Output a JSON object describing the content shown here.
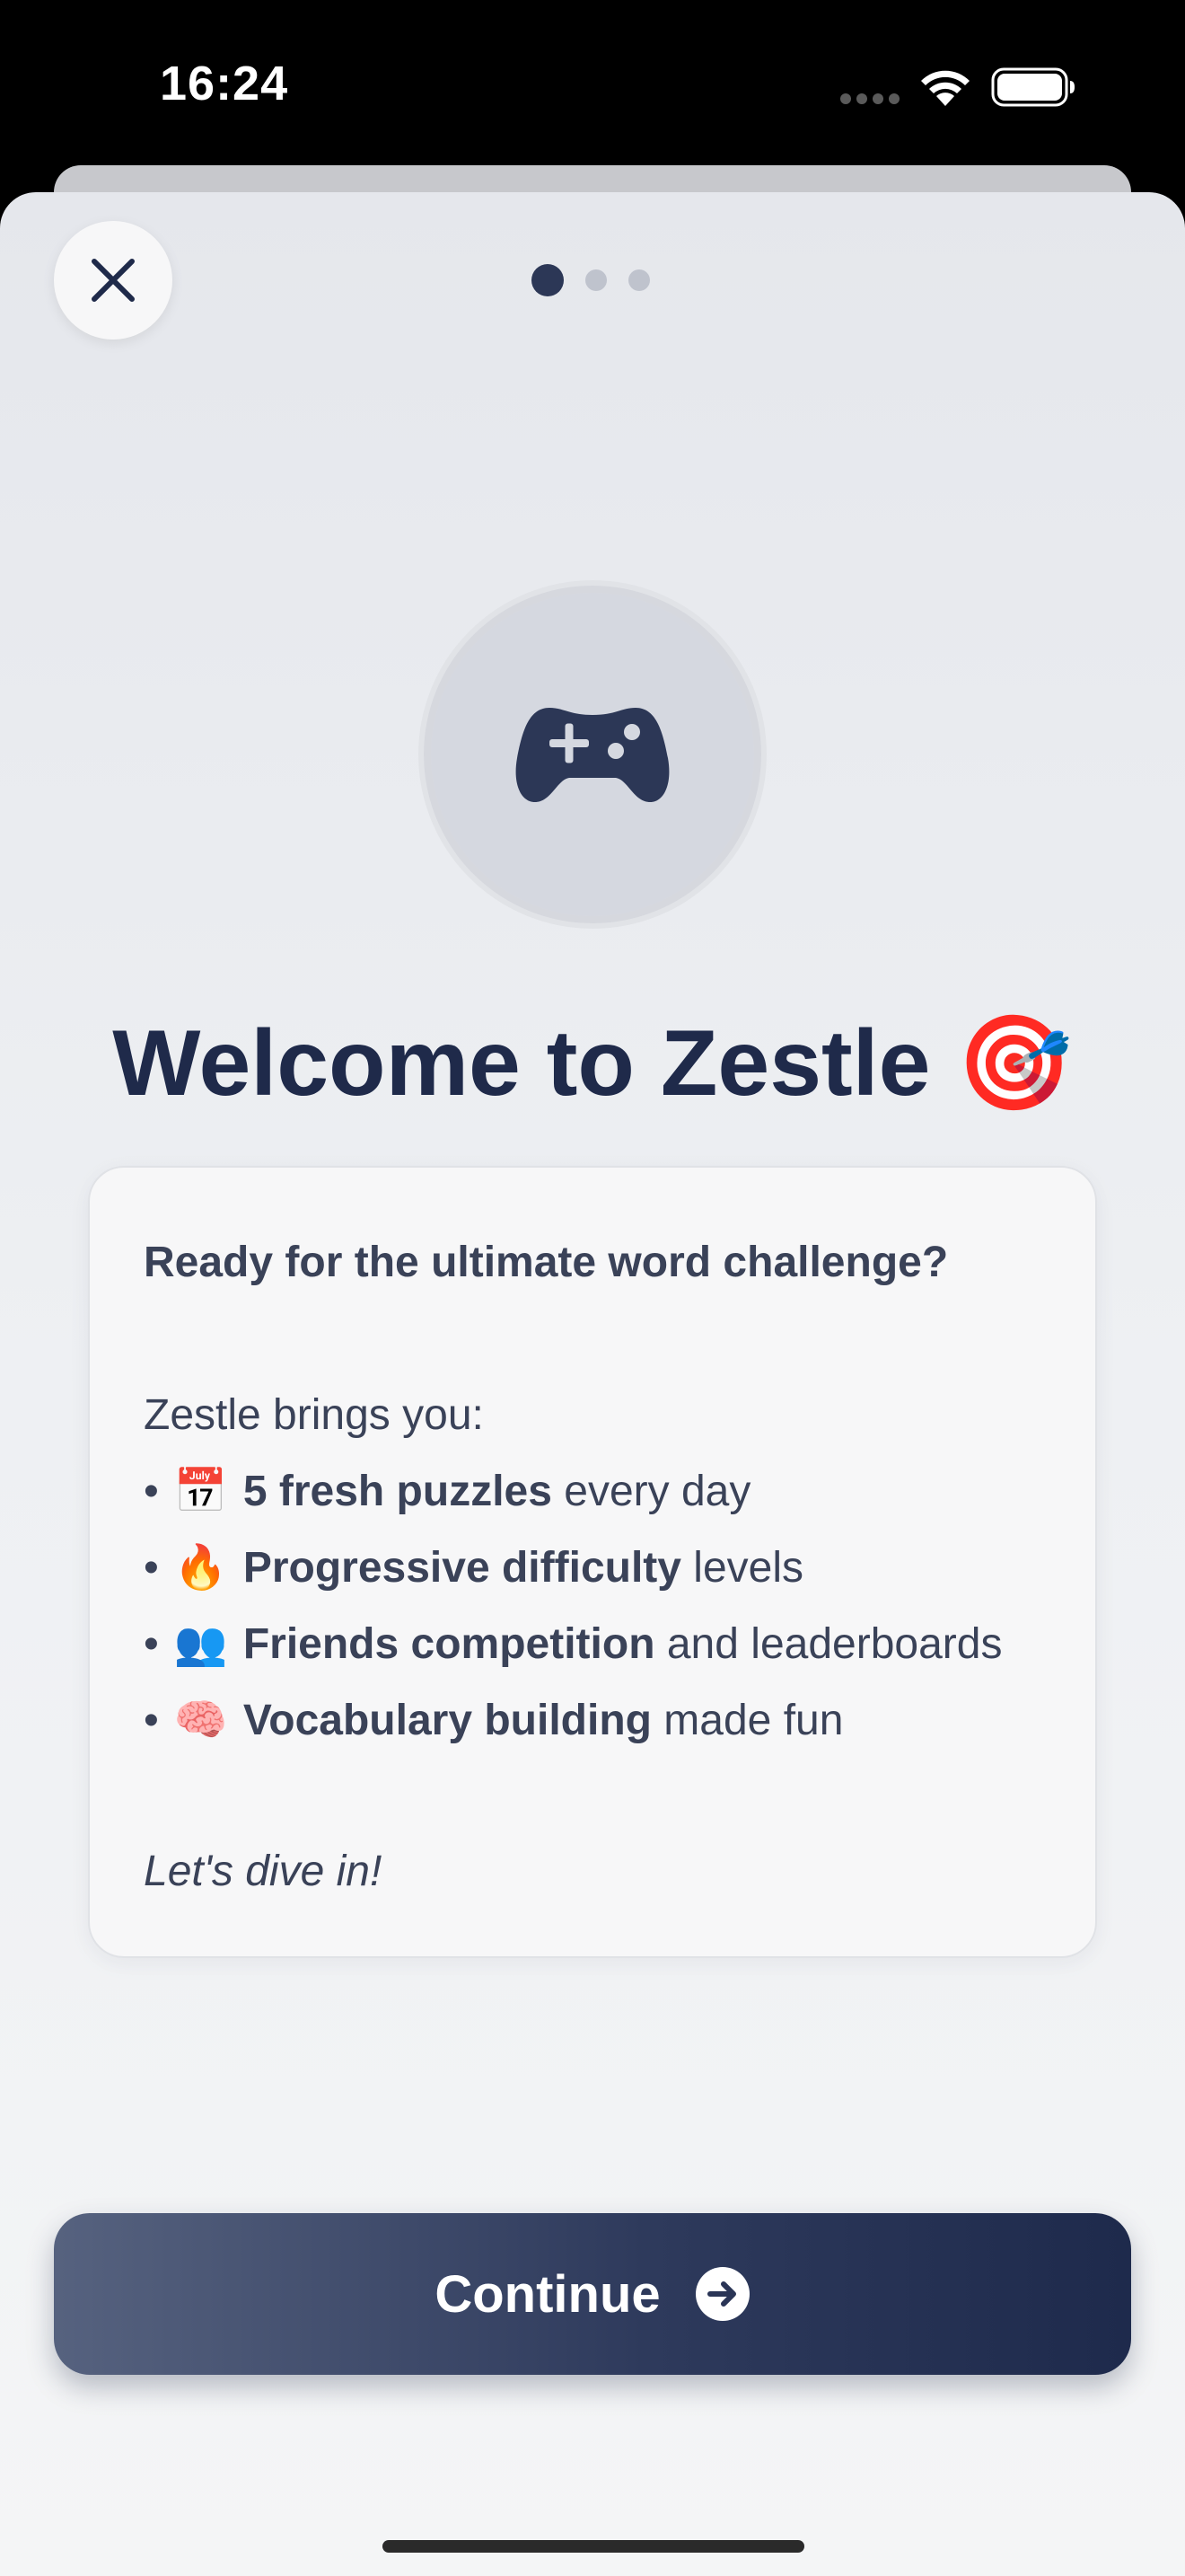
{
  "status_bar": {
    "time": "16:24"
  },
  "header": {
    "close_icon": "close-icon",
    "page_indicator": {
      "total": 3,
      "current": 1
    }
  },
  "hero": {
    "icon": "gamepad-icon"
  },
  "title": "Welcome to Zestle 🎯",
  "card": {
    "intro": "Ready for the ultimate word challenge?",
    "brings": "Zestle brings you:",
    "features": [
      {
        "emoji": "📅",
        "bold": "5 fresh puzzles",
        "rest": " every day"
      },
      {
        "emoji": "🔥",
        "bold": "Progressive difficulty",
        "rest": " levels"
      },
      {
        "emoji": "👥",
        "bold": "Friends competition",
        "rest": " and leaderboards"
      },
      {
        "emoji": "🧠",
        "bold": "Vocabulary building",
        "rest": " made fun"
      }
    ],
    "outro": "Let's dive in!"
  },
  "continue_button": {
    "label": "Continue",
    "icon": "arrow-right-circle-icon"
  },
  "colors": {
    "primary_navy": "#1f2a4a",
    "button_gradient_start": "#56627f",
    "button_gradient_end": "#1e2a4c",
    "background": "#eef0f3"
  }
}
